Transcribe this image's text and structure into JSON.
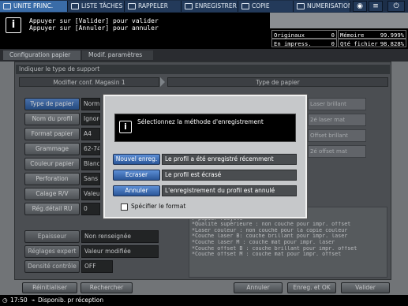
{
  "tabs": [
    {
      "label": "UNITE PRINC.",
      "active": true
    },
    {
      "label": "LISTE TÂCHES",
      "active": false
    },
    {
      "label": "RAPPELER",
      "active": false
    },
    {
      "label": "ENREGISTRER",
      "active": false
    },
    {
      "label": "COPIE",
      "active": false
    },
    {
      "label": "NUMERISATION",
      "active": false
    }
  ],
  "tab_buttons": {
    "globe": "◉",
    "menu": "≡"
  },
  "message": {
    "line1": "Appuyer sur [Valider] pour valider",
    "line2": "Appuyer sur [Annuler] pour annuler"
  },
  "counters": {
    "originals_label": "Originaux",
    "originals_value": "0",
    "memory_label": "Mémoire",
    "memory_value": "99.999%",
    "printing_label": "En impress.",
    "printing_value": "0",
    "file_qty_label": "Qté fichier",
    "file_qty_value": "98.828%"
  },
  "breadcrumb": [
    "Configuration papier",
    "Modif. paramètres"
  ],
  "panel_title": "Indiquer le type de support",
  "columns": {
    "left": "Modifier conf.     Magasin 1",
    "right": "Type de papier"
  },
  "rows": [
    {
      "label": "Type de papier",
      "value": "Normal",
      "selected": true
    },
    {
      "label": "Nom du profil",
      "value": "Ignorer",
      "selected": false
    },
    {
      "label": "Format papier",
      "value": "A4",
      "selected": false
    },
    {
      "label": "Grammage",
      "value": "62-74",
      "selected": false
    },
    {
      "label": "Couleur papier",
      "value": "Blanc",
      "selected": false
    },
    {
      "label": "Perforation",
      "value": "Sans",
      "selected": false
    },
    {
      "label": "Calage R/V",
      "value": "Valeur",
      "selected": false
    },
    {
      "label": "Rég.détail RU",
      "value": "0",
      "selected": false
    }
  ],
  "right_options": [
    "Laser brillant",
    "2é laser mat",
    "Offset brillant",
    "2é offset mat"
  ],
  "description_lines": [
    "                             aire",
    "                             r papier recyclé",
    "*Qualité supérieure : non couché pour impr. offset",
    "*Laser couleur : non couché pour la copie couleur",
    "*Couche laser B: couche brillant pour impr. laser",
    "*Couche laser M : couche mat pour impr. laser",
    "*Couche offset B : couche brillant pour impr. offset",
    "*Couche offset M : couche mat pour impr. offset"
  ],
  "lower_rows": [
    {
      "label": "Epaisseur",
      "value": "Non renseignée"
    },
    {
      "label": "Réglages expert",
      "value": "Valeur modifiée"
    },
    {
      "label": "Densité contrôle",
      "value": "OFF"
    }
  ],
  "bottom_buttons": {
    "reset": "Réinitialiser",
    "search": "Rechercher",
    "cancel": "Annuler",
    "save_ok": "Enreg. et OK",
    "validate": "Valider"
  },
  "status": {
    "time": "17:50",
    "text": "Disponib. pr réception"
  },
  "dialog": {
    "message": "Sélectionnez la méthode d'enregistrement",
    "options": [
      {
        "button": "Nouvel enreg.",
        "description": "Le profil a été enregistré récemment"
      },
      {
        "button": "Ecraser",
        "description": "Le profil est écrasé"
      },
      {
        "button": "Annuler",
        "description": "L'enregistrement du profil est annulé"
      }
    ],
    "checkbox_label": "Spécifier le format",
    "checkbox_checked": false
  }
}
